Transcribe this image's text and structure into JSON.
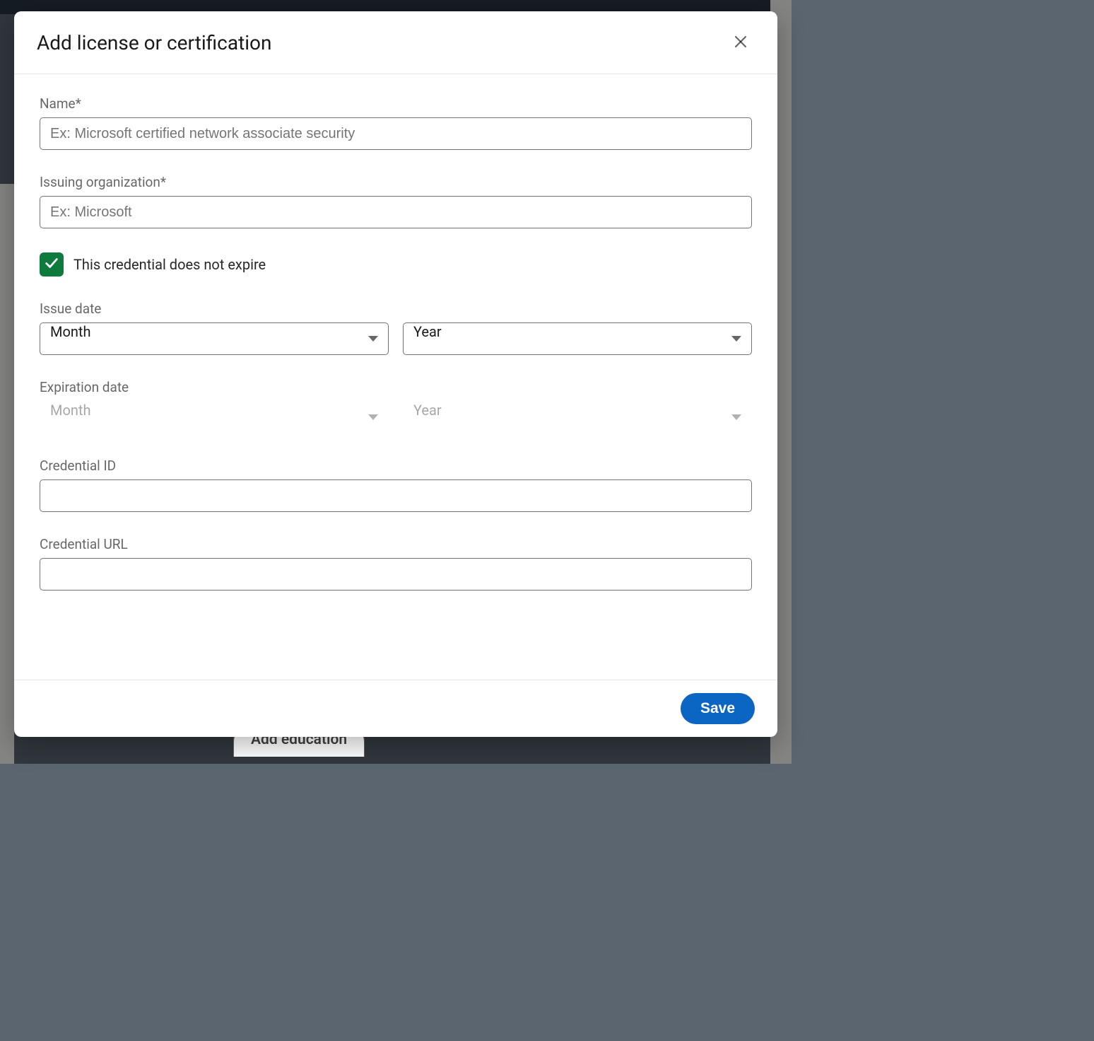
{
  "modal": {
    "title": "Add license or certification",
    "name_label": "Name*",
    "name_placeholder": "Ex: Microsoft certified network associate security",
    "name_value": "",
    "org_label": "Issuing organization*",
    "org_placeholder": "Ex: Microsoft",
    "org_value": "",
    "no_expire_label": "This credential does not expire",
    "no_expire_checked": true,
    "issue_date_label": "Issue date",
    "issue_month": "Month",
    "issue_year": "Year",
    "expiration_date_label": "Expiration date",
    "expiration_month": "Month",
    "expiration_year": "Year",
    "credential_id_label": "Credential ID",
    "credential_id_value": "",
    "credential_url_label": "Credential URL",
    "credential_url_value": "",
    "save_label": "Save"
  },
  "background": {
    "add_education": "Add education"
  }
}
